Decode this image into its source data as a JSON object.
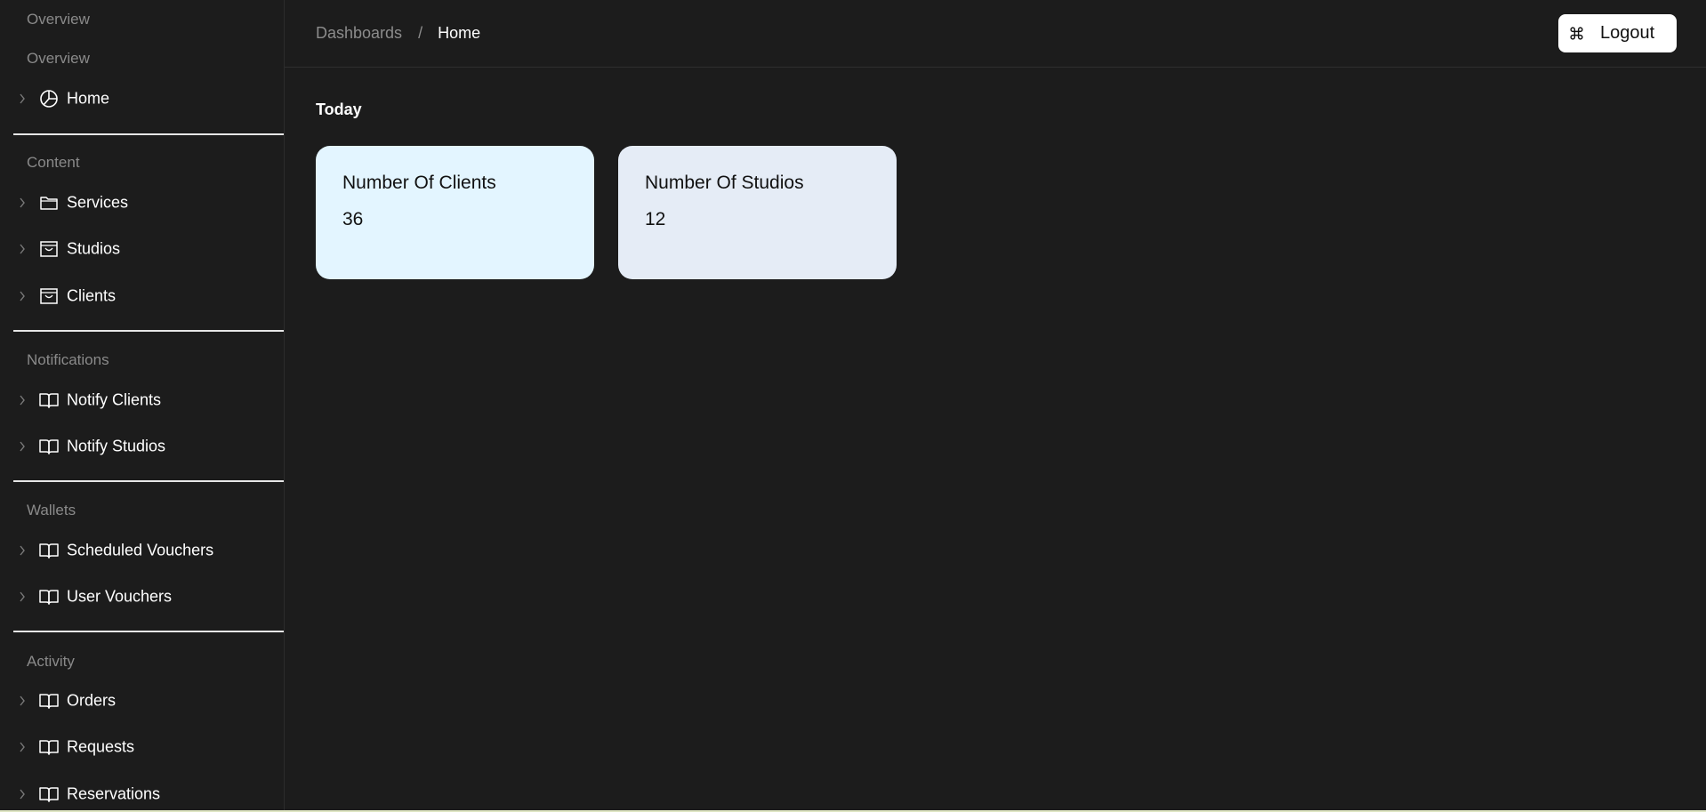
{
  "sidebar": {
    "sections": [
      {
        "title": "Overview"
      },
      {
        "title": "Overview"
      },
      {
        "title": "Content"
      },
      {
        "title": "Notifications"
      },
      {
        "title": "Wallets"
      },
      {
        "title": "Activity"
      }
    ],
    "items": [
      {
        "label": "Home",
        "icon": "pie-chart-icon"
      },
      {
        "label": "Services",
        "icon": "folder-icon"
      },
      {
        "label": "Studios",
        "icon": "archive-icon"
      },
      {
        "label": "Clients",
        "icon": "archive-icon"
      },
      {
        "label": "Notify Clients",
        "icon": "book-open-icon"
      },
      {
        "label": "Notify Studios",
        "icon": "book-open-icon"
      },
      {
        "label": "Scheduled Vouchers",
        "icon": "book-open-icon"
      },
      {
        "label": "User Vouchers",
        "icon": "book-open-icon"
      },
      {
        "label": "Orders",
        "icon": "book-open-icon"
      },
      {
        "label": "Requests",
        "icon": "book-open-icon"
      },
      {
        "label": "Reservations",
        "icon": "book-open-icon"
      }
    ]
  },
  "header": {
    "breadcrumb": {
      "parent": "Dashboards",
      "separator": "/",
      "current": "Home"
    },
    "logout_label": "Logout",
    "logout_icon": "command-icon"
  },
  "main": {
    "heading": "Today",
    "cards": [
      {
        "title": "Number Of Clients",
        "value": "36",
        "color": "#e3f5ff"
      },
      {
        "title": "Number Of Studios",
        "value": "12",
        "color": "#e5ecf6"
      }
    ]
  },
  "colors": {
    "background": "#1c1c1c",
    "muted_text": "#8a8a8a",
    "text": "#ffffff",
    "divider": "#e6e6e6"
  }
}
